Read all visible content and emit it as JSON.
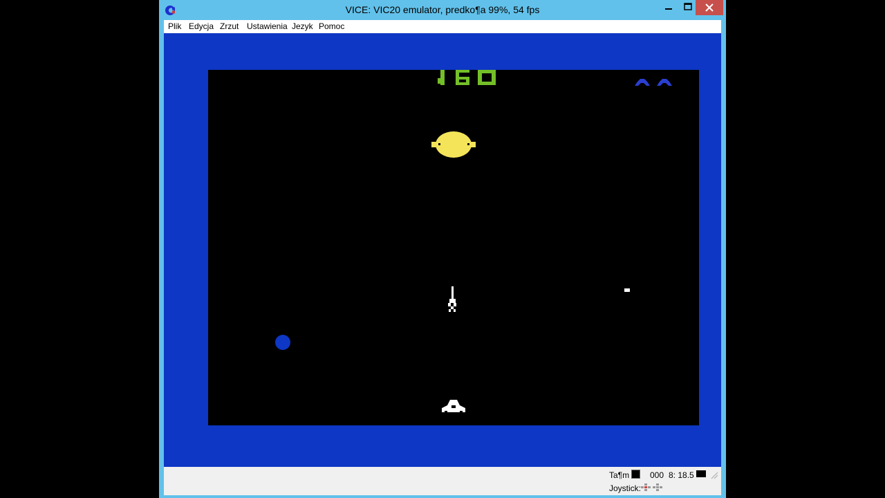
{
  "window": {
    "title": "VICE: VIC20 emulator, predko¶a 99%, 54 fps",
    "icon": "commodore-logo-icon"
  },
  "menu": {
    "items": [
      "Plik",
      "Edycja",
      "Zrzut",
      "Ustawienia",
      "Jezyk",
      "Pomoc"
    ]
  },
  "game": {
    "score": "160",
    "lives_shown": 2
  },
  "status": {
    "tape_label": "Ta¶m",
    "tape_counter": "000",
    "drive_track": "8: 18.5",
    "joystick_label": "Joystick:"
  },
  "colors": {
    "titlebar": "#62c1ea",
    "close_button": "#c7504c",
    "border_blue": "#0d37c4",
    "screen_black": "#000000",
    "score_green": "#74bf28",
    "sun_yellow": "#f4e45a",
    "lives_blue": "#2a3fd0"
  }
}
